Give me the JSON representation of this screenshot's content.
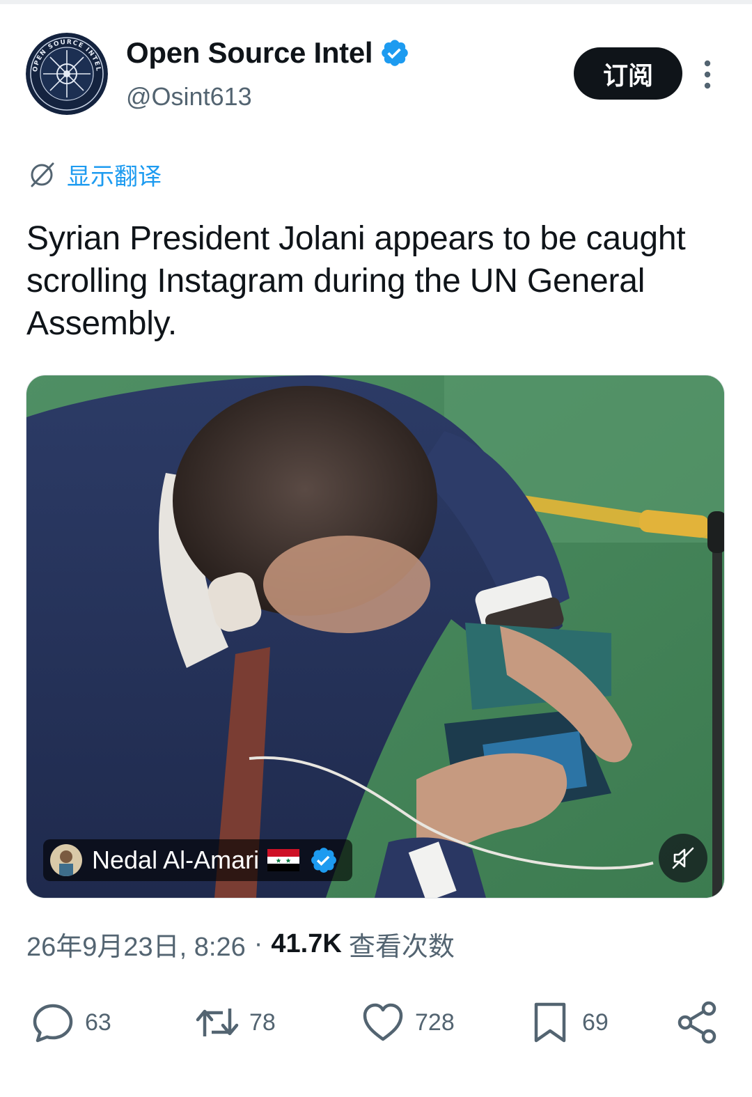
{
  "account": {
    "display_name": "Open Source Intel",
    "handle": "@Osint613",
    "avatar_text": "OPEN SOURCE INTEL",
    "verified": true
  },
  "header": {
    "subscribe_label": "订阅",
    "more_icon": "more-vertical-icon"
  },
  "translate": {
    "label": "显示翻译",
    "icon": "translate-icon"
  },
  "tweet": {
    "text": "Syrian President Jolani appears to be caught scrolling Instagram during the UN General Assembly."
  },
  "media": {
    "attribution_name": "Nedal Al-Amari",
    "attribution_verified": true,
    "flag": "syria-flag",
    "mute_icon": "muted-speaker-icon"
  },
  "meta": {
    "timestamp": "26年9月23日, 8:26",
    "separator": "·",
    "views_count": "41.7K",
    "views_label": "查看次数"
  },
  "actions": {
    "replies": "63",
    "reposts": "78",
    "likes": "728",
    "bookmarks": "69"
  },
  "colors": {
    "accent": "#1d9bf0",
    "text": "#0f1419",
    "secondary": "#536471"
  }
}
